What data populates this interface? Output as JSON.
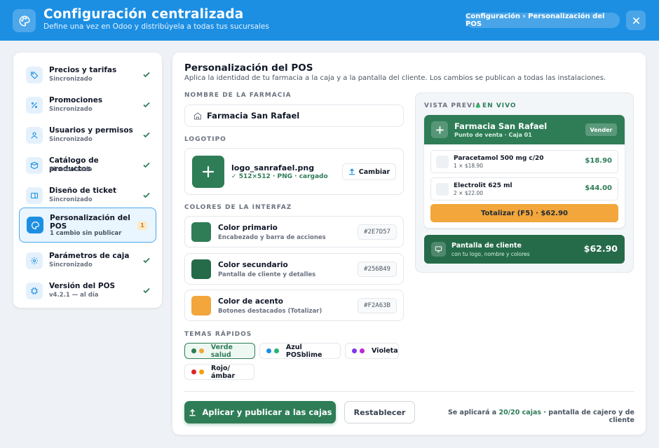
{
  "header": {
    "title": "Configuración centralizada",
    "subtitle": "Define una vez en Odoo y distribúyela a todas tus sucursales",
    "breadcrumb": "Configuración › Personalización del POS",
    "app_icon": "palette-icon",
    "close_icon": "close-icon"
  },
  "sidebar": {
    "items": [
      {
        "label": "Precios y tarifas",
        "status": "Sincronizado",
        "icon": "tag-icon",
        "state": "synced"
      },
      {
        "label": "Promociones",
        "status": "Sincronizado",
        "icon": "percent-icon",
        "state": "synced"
      },
      {
        "label": "Usuarios y permisos",
        "status": "Sincronizado",
        "icon": "user-icon",
        "state": "synced"
      },
      {
        "label": "Catálogo de productos",
        "status": "Sincronizado",
        "icon": "box-icon",
        "state": "synced"
      },
      {
        "label": "Diseño de ticket",
        "status": "Sincronizado",
        "icon": "receipt-icon",
        "state": "synced"
      },
      {
        "label": "Personalización del POS",
        "status": "1 cambio sin publicar",
        "icon": "palette-icon",
        "state": "active",
        "badge": "1"
      },
      {
        "label": "Parámetros de caja",
        "status": "Sincronizado",
        "icon": "gear-icon",
        "state": "synced"
      },
      {
        "label": "Versión del POS",
        "status": "v4.2.1 — al día",
        "icon": "chip-icon",
        "state": "synced"
      }
    ]
  },
  "main": {
    "title": "Personalización del POS",
    "description": "Aplica la identidad de tu farmacia a la caja y a la pantalla del cliente. Los cambios se publican a todas las instalaciones.",
    "store_name_label": "NOMBRE DE LA FARMACIA",
    "store_name": "Farmacia San Rafael",
    "logo_label": "LOGOTIPO",
    "logo_file": "logo_sanrafael.png",
    "logo_meta": "512×512 · PNG · cargado",
    "change_label": "Cambiar",
    "colors_label": "COLORES DE LA INTERFAZ",
    "colors": [
      {
        "name": "Color primario",
        "desc": "Encabezado y barra de acciones",
        "hex": "#2E7D57"
      },
      {
        "name": "Color secundario",
        "desc": "Pantalla de cliente y detalles",
        "hex": "#256B49"
      },
      {
        "name": "Color de acento",
        "desc": "Botones destacados (Totalizar)",
        "hex": "#F2A63B"
      }
    ],
    "themes_label": "TEMAS RÁPIDOS",
    "themes": [
      {
        "label": "Verde salud",
        "dots": [
          "#2E7D57",
          "#F2A63B"
        ],
        "active": true
      },
      {
        "label": "Azul POSblime",
        "dots": [
          "#1C8FE3",
          "#22B573"
        ],
        "active": false
      },
      {
        "label": "Violeta",
        "dots": [
          "#7C3AED",
          "#C026D3"
        ],
        "active": false
      },
      {
        "label": "Rojo/ámbar",
        "dots": [
          "#DC2626",
          "#F59E0B"
        ],
        "active": false
      }
    ],
    "apply_label": "Aplicar y publicar a las cajas",
    "reset_label": "Restablecer",
    "apply_note_pre": "Se aplicará a",
    "apply_note_count": "20/20 cajas",
    "apply_note_post": "· pantalla de cajero y de cliente"
  },
  "preview": {
    "label": "VISTA PREVIA",
    "live": "EN VIVO",
    "pos_name": "Farmacia San Rafael",
    "pos_sub": "Punto de venta · Caja 01",
    "sell_label": "Vender",
    "lines": [
      {
        "item": "Paracetamol 500 mg c/20",
        "qty": "1 × $18.90",
        "price": "$18.90"
      },
      {
        "item": "Electrolit 625 ml",
        "qty": "2 × $22.00",
        "price": "$44.00"
      }
    ],
    "total_label": "Totalizar (F5) · $62.90",
    "customer_title": "Pantalla de cliente",
    "customer_sub": "con tu logo, nombre y colores",
    "customer_amount": "$62.90"
  }
}
